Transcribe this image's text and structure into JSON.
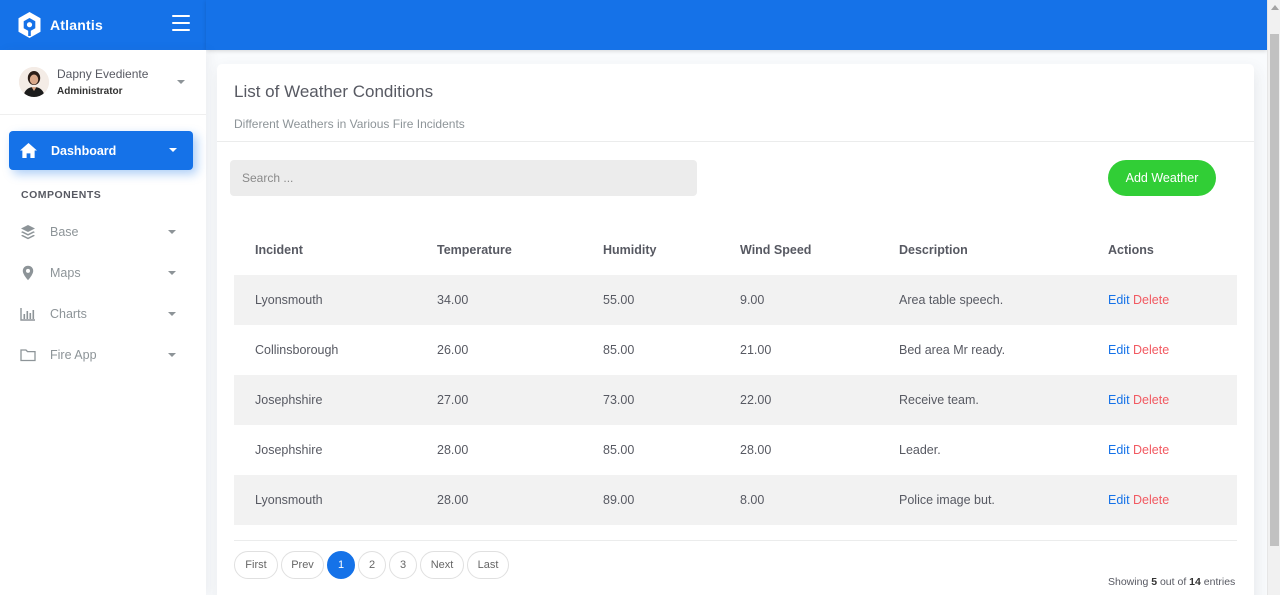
{
  "brand": {
    "name": "Atlantis"
  },
  "user": {
    "name": "Dapny Evediente",
    "role": "Administrator"
  },
  "sidebar": {
    "dashboard_label": "Dashboard",
    "section_title": "COMPONENTS",
    "items": [
      {
        "label": "Base",
        "icon": "layers-icon"
      },
      {
        "label": "Maps",
        "icon": "map-pin-icon"
      },
      {
        "label": "Charts",
        "icon": "bar-chart-icon"
      },
      {
        "label": "Fire App",
        "icon": "folder-icon"
      }
    ]
  },
  "card": {
    "title": "List of Weather Conditions",
    "subtitle": "Different Weathers in Various Fire Incidents",
    "search_placeholder": "Search ...",
    "add_button": "Add Weather"
  },
  "table": {
    "headers": [
      "Incident",
      "Temperature",
      "Humidity",
      "Wind Speed",
      "Description",
      "Actions"
    ],
    "rows": [
      {
        "incident": "Lyonsmouth",
        "temperature": "34.00",
        "humidity": "55.00",
        "wind_speed": "9.00",
        "description": "Area table speech."
      },
      {
        "incident": "Collinsborough",
        "temperature": "26.00",
        "humidity": "85.00",
        "wind_speed": "21.00",
        "description": "Bed area Mr ready."
      },
      {
        "incident": "Josephshire",
        "temperature": "27.00",
        "humidity": "73.00",
        "wind_speed": "22.00",
        "description": "Receive team."
      },
      {
        "incident": "Josephshire",
        "temperature": "28.00",
        "humidity": "85.00",
        "wind_speed": "28.00",
        "description": "Leader."
      },
      {
        "incident": "Lyonsmouth",
        "temperature": "28.00",
        "humidity": "89.00",
        "wind_speed": "8.00",
        "description": "Police image but."
      }
    ],
    "edit_label": "Edit",
    "delete_label": "Delete"
  },
  "pagination": {
    "first": "First",
    "prev": "Prev",
    "pages": [
      "1",
      "2",
      "3"
    ],
    "active_page": "1",
    "next": "Next",
    "last": "Last",
    "showing_prefix": "Showing",
    "showing_count": "5",
    "showing_mid": "out of",
    "showing_total": "14",
    "showing_suffix": "entries"
  },
  "colors": {
    "primary": "#1572e8",
    "success": "#31ce36",
    "danger": "#f25961"
  }
}
